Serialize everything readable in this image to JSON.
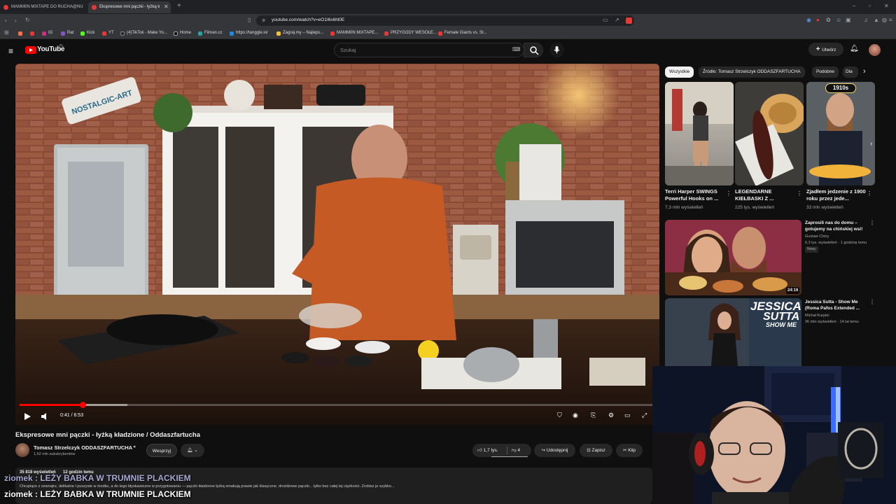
{
  "browser": {
    "tabs": [
      {
        "title": "MAMM0N MIXTAPE DO RUCHA@NU",
        "active": false
      },
      {
        "title": "Ekspresowe mni pączki - łyżką k",
        "active": true
      }
    ],
    "url": "youtube.com/watch?v=eO1I6s6hl0E",
    "bookmarks": [
      "IG",
      "Rat",
      "Kick",
      "YT",
      "(4)TikTok - Make Yo...",
      "Home",
      "Filman.cc",
      "https://tanggle.io/",
      "Zagraj.my – Najleps...",
      "MAMM0N MIXTAPE...",
      "PRZYGODY WESOŁE...",
      "Female Giants vs. St..."
    ]
  },
  "youtube": {
    "logo": "YouTube",
    "region": "PL",
    "search_placeholder": "Szukaj",
    "create_label": "Utwórz"
  },
  "player": {
    "time": "0:41 / 6:53",
    "progress": 0.099,
    "buffered": 0.17
  },
  "video": {
    "title": "Ekspresowe mni pączki - łyżką kładzione / Oddaszfartucha",
    "channel": "Tomasz Strzelczyk ODDASZFARTUCHA",
    "subscribers": "1,62 mln subskrybentów",
    "join_label": "Wesprzyj",
    "likes": "1,7 tys.",
    "dislikes": "4",
    "share_label": "Udostępnij",
    "save_label": "Zapisz",
    "clip_label": "Klip",
    "views": "35 818 wyświetleń",
    "age": "12 godzin temu",
    "description": "Chrupiące z zewnątrz, delikatne i puszyste w środku, a do tego błyskawiczne w przygotowaniu — pączki kładzione łyżką smakują prawie jak klasyczne, drożdżowe pączki... tylko bez całej tej ciężkości. Zrobisz je szybko..."
  },
  "sidebar": {
    "chips": [
      "Wszystkie",
      "Źródło: Tomasz Strzelczyk ODDASZFARTUCHA",
      "Podobne",
      "Dla"
    ],
    "shorts": [
      {
        "title": "Terri Harper SWINGS Powerful Hooks on ...",
        "views": "7,3 mln wyświetleń"
      },
      {
        "title": "LEGENDARNE KIEŁBASKI Z ...",
        "views": "225 tys. wyświetleń"
      },
      {
        "title": "Zjadłem jedzenie z 1900 roku przez jede...",
        "views": "33 mln wyświetleń",
        "badge": "1910s"
      }
    ],
    "videos": [
      {
        "title": "Zaprosili nas do domu – gotujemy na chińskiej wsi!",
        "channel": "Gustaw Chiny",
        "meta": "6,3 tys. wyświetleń · 1 godzinę temu",
        "badge": "Nowy",
        "duration": "24:16"
      },
      {
        "title": "Jessica Sutta - Show Me (Roma Pafos Extended ...",
        "channel": "Michał Kurpiel",
        "meta": "36 mln wyświetleń · 14 lat temu",
        "thumb_text1": "JESSICA",
        "thumb_text2": "SUTTA",
        "thumb_text3": "SHOW ME"
      }
    ]
  },
  "overlay": {
    "chat_line1": "ziomek : LEŻY BABKA W TRUMNIE PLACKIEM",
    "chat_line2": "ziomek : LEŻY BABKA W TRUMNIE PLACKIEM"
  }
}
